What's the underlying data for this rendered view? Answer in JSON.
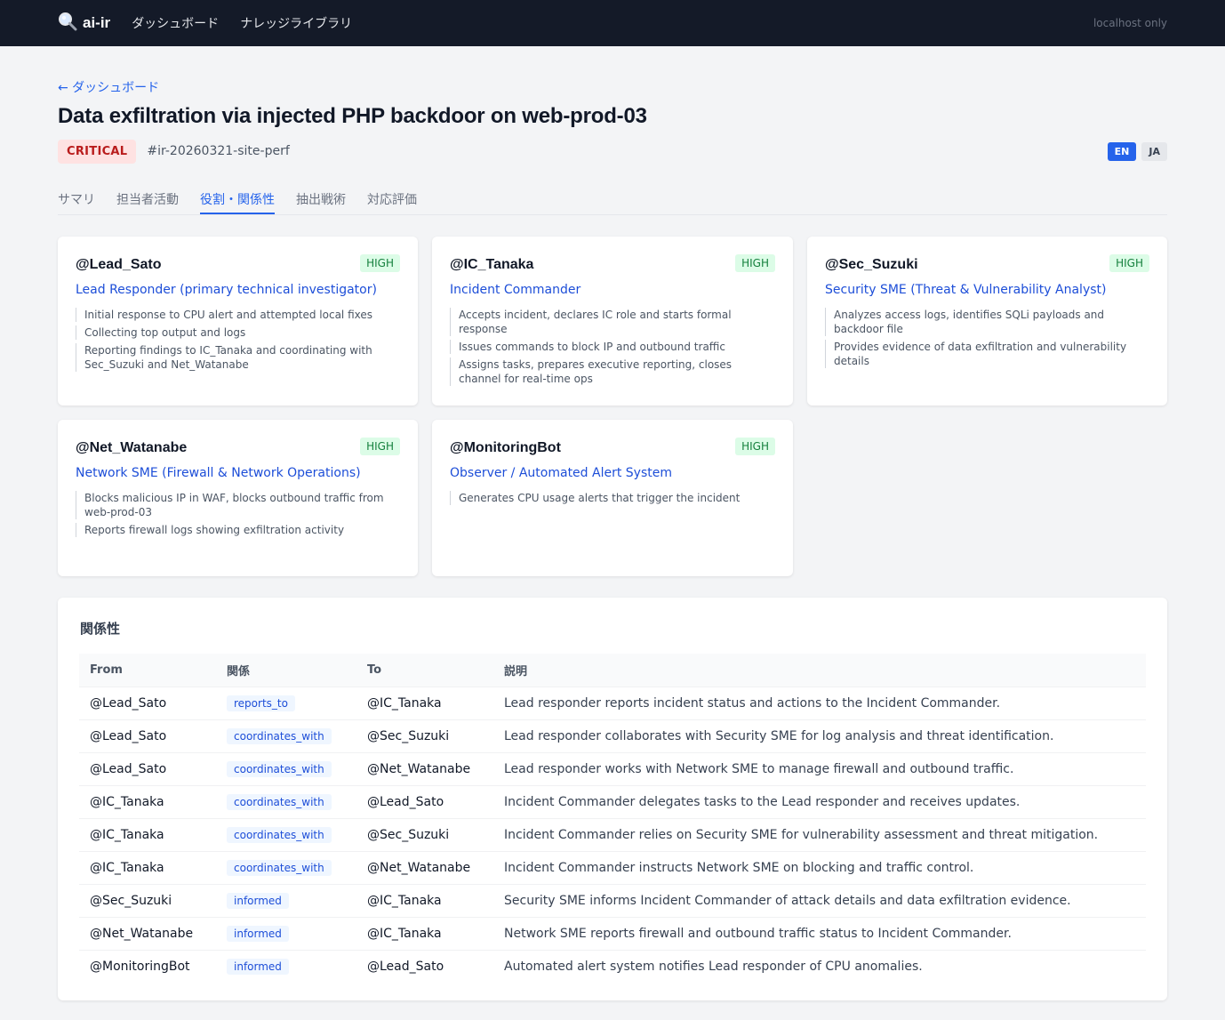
{
  "header": {
    "brand": "ai-ir",
    "nav": [
      "ダッシュボード",
      "ナレッジライブラリ"
    ],
    "status": "localhost only"
  },
  "page": {
    "back_label": "← ダッシュボード",
    "title": "Data exfiltration via injected PHP backdoor on web-prod-03",
    "severity": "CRITICAL",
    "channel": "#ir-20260321-site-perf",
    "lang_active": "EN",
    "lang_other": "JA"
  },
  "tabs": [
    {
      "label": "サマリ",
      "active": false
    },
    {
      "label": "担当者活動",
      "active": false
    },
    {
      "label": "役割・関係性",
      "active": true
    },
    {
      "label": "抽出戦術",
      "active": false
    },
    {
      "label": "対応評価",
      "active": false
    }
  ],
  "cards": [
    {
      "name": "@Lead_Sato",
      "confidence": "HIGH",
      "role": "Lead Responder (primary technical investigator)",
      "items": [
        "Initial response to CPU alert and attempted local fixes",
        "Collecting top output and logs",
        "Reporting findings to IC_Tanaka and coordinating with Sec_Suzuki and Net_Watanabe"
      ]
    },
    {
      "name": "@IC_Tanaka",
      "confidence": "HIGH",
      "role": "Incident Commander",
      "items": [
        "Accepts incident, declares IC role and starts formal response",
        "Issues commands to block IP and outbound traffic",
        "Assigns tasks, prepares executive reporting, closes channel for real-time ops"
      ]
    },
    {
      "name": "@Sec_Suzuki",
      "confidence": "HIGH",
      "role": "Security SME (Threat & Vulnerability Analyst)",
      "items": [
        "Analyzes access logs, identifies SQLi payloads and backdoor file",
        "Provides evidence of data exfiltration and vulnerability details"
      ]
    },
    {
      "name": "@Net_Watanabe",
      "confidence": "HIGH",
      "role": "Network SME (Firewall & Network Operations)",
      "items": [
        "Blocks malicious IP in WAF, blocks outbound traffic from web-prod-03",
        "Reports firewall logs showing exfiltration activity"
      ]
    },
    {
      "name": "@MonitoringBot",
      "confidence": "HIGH",
      "role": "Observer / Automated Alert System",
      "items": [
        "Generates CPU usage alerts that trigger the incident"
      ]
    }
  ],
  "relations": {
    "title": "関係性",
    "headers": [
      "From",
      "関係",
      "To",
      "説明"
    ],
    "rows": [
      {
        "from": "@Lead_Sato",
        "type": "reports_to",
        "to": "@IC_Tanaka",
        "desc": "Lead responder reports incident status and actions to the Incident Commander."
      },
      {
        "from": "@Lead_Sato",
        "type": "coordinates_with",
        "to": "@Sec_Suzuki",
        "desc": "Lead responder collaborates with Security SME for log analysis and threat identification."
      },
      {
        "from": "@Lead_Sato",
        "type": "coordinates_with",
        "to": "@Net_Watanabe",
        "desc": "Lead responder works with Network SME to manage firewall and outbound traffic."
      },
      {
        "from": "@IC_Tanaka",
        "type": "coordinates_with",
        "to": "@Lead_Sato",
        "desc": "Incident Commander delegates tasks to the Lead responder and receives updates."
      },
      {
        "from": "@IC_Tanaka",
        "type": "coordinates_with",
        "to": "@Sec_Suzuki",
        "desc": "Incident Commander relies on Security SME for vulnerability assessment and threat mitigation."
      },
      {
        "from": "@IC_Tanaka",
        "type": "coordinates_with",
        "to": "@Net_Watanabe",
        "desc": "Incident Commander instructs Network SME on blocking and traffic control."
      },
      {
        "from": "@Sec_Suzuki",
        "type": "informed",
        "to": "@IC_Tanaka",
        "desc": "Security SME informs Incident Commander of attack details and data exfiltration evidence."
      },
      {
        "from": "@Net_Watanabe",
        "type": "informed",
        "to": "@IC_Tanaka",
        "desc": "Network SME reports firewall and outbound traffic status to Incident Commander."
      },
      {
        "from": "@MonitoringBot",
        "type": "informed",
        "to": "@Lead_Sato",
        "desc": "Automated alert system notifies Lead responder of CPU anomalies."
      }
    ]
  },
  "colors": {
    "topbar": "#141a28",
    "accent": "#2563eb",
    "critical_bg": "#fee2e2",
    "critical_fg": "#b91c1c",
    "high_bg": "#dcfce7",
    "high_fg": "#15803d"
  },
  "icons": {
    "brand_icon": "magnifier-icon"
  }
}
